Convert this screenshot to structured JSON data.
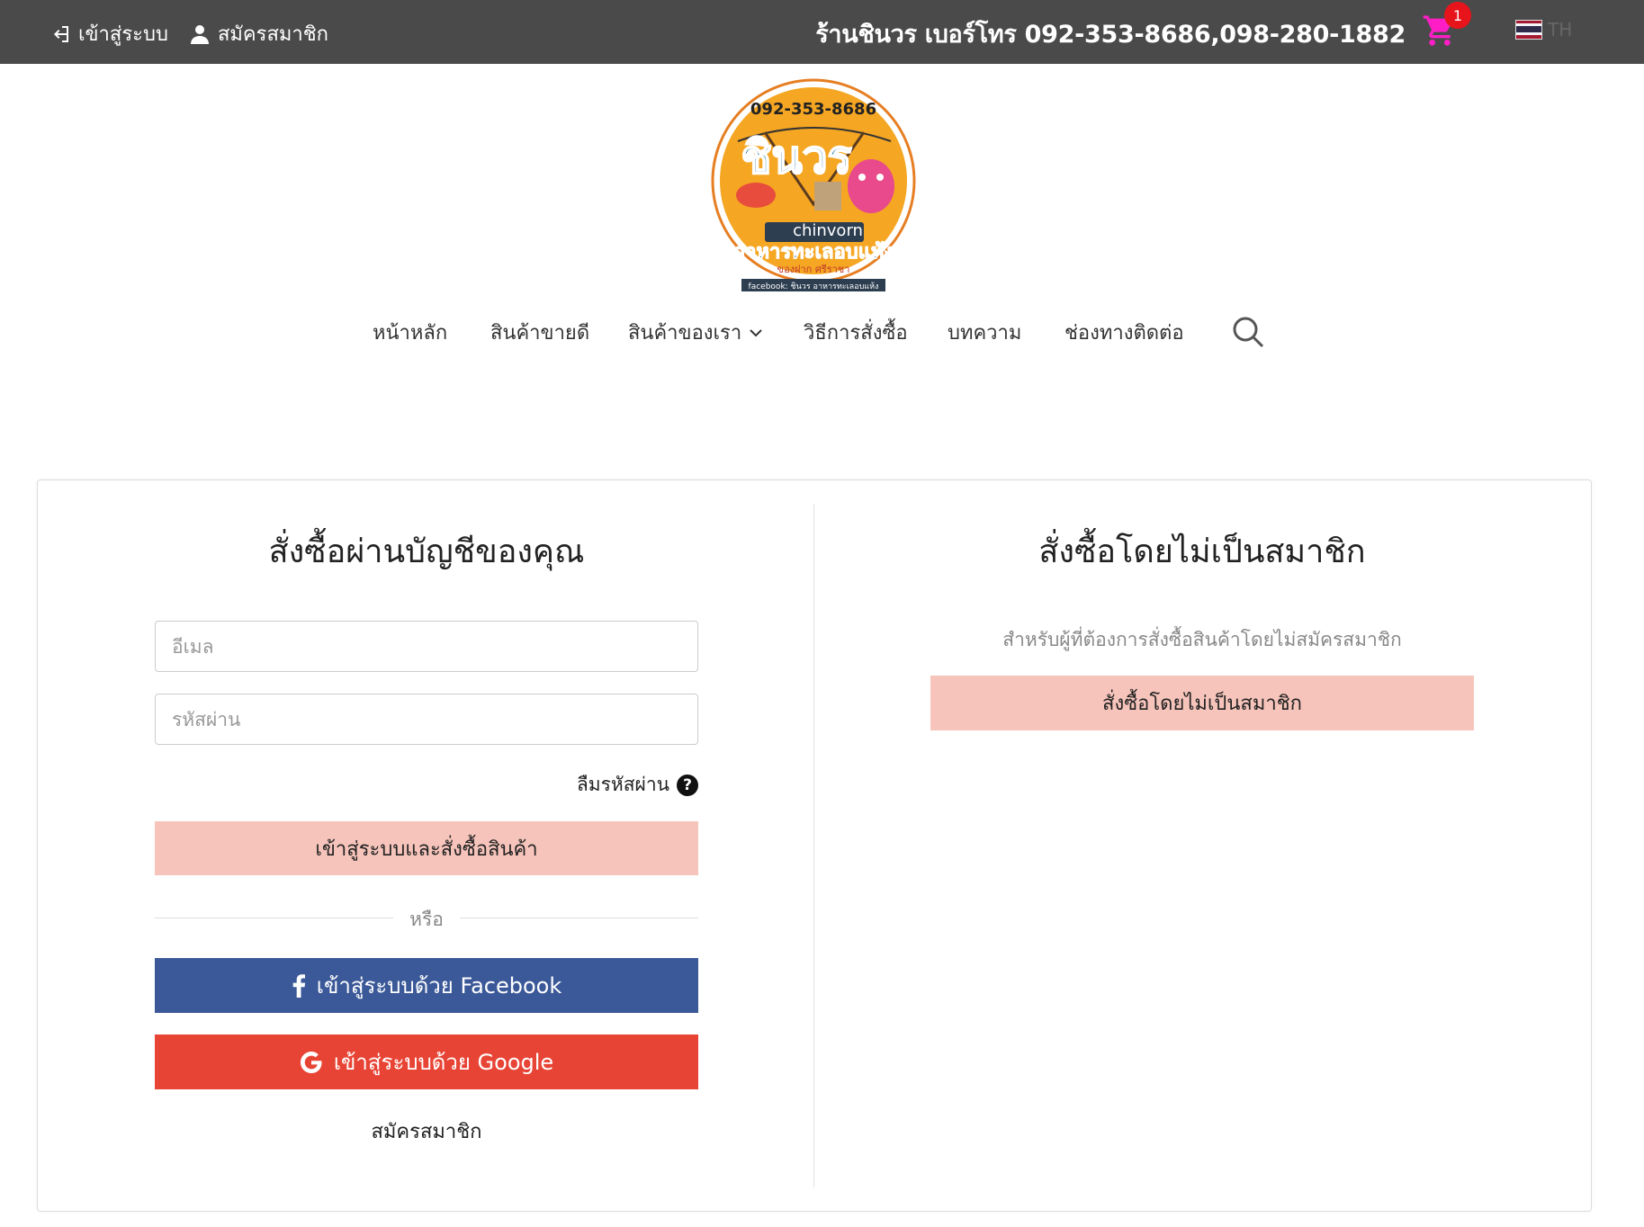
{
  "topbar": {
    "login_label": "เข้าสู่ระบบ",
    "register_label": "สมัครสมาชิก",
    "shop_phone": "ร้านชินวร เบอร์โทร 092-353-8686,098-280-1882",
    "cart_count": "1",
    "language": "TH"
  },
  "logo": {
    "phone": "092-353-8686",
    "brand": "ชินวร",
    "line_id": "chinvorn",
    "tagline": "อาหารทะเลอบแห้ง",
    "subtitle": "ของฝาก ศรีราชา",
    "facebook": "facebook: ชินวร อาหารทะเลอบแห้ง"
  },
  "nav": {
    "items": [
      {
        "label": "หน้าหลัก"
      },
      {
        "label": "สินค้าขายดี"
      },
      {
        "label": "สินค้าของเรา"
      },
      {
        "label": "วิธีการสั่งซื้อ"
      },
      {
        "label": "บทความ"
      },
      {
        "label": "ช่องทางติดต่อ"
      }
    ]
  },
  "member": {
    "title": "สั่งซื้อผ่านบัญชีของคุณ",
    "email_placeholder": "อีเมล",
    "password_placeholder": "รหัสผ่าน",
    "forgot_label": "ลืมรหัสผ่าน",
    "login_button": "เข้าสู่ระบบและสั่งซื้อสินค้า",
    "or_label": "หรือ",
    "facebook_button": "เข้าสู่ระบบด้วย Facebook",
    "google_button": "เข้าสู่ระบบด้วย Google",
    "register_link": "สมัครสมาชิก"
  },
  "guest": {
    "title": "สั่งซื้อโดยไม่เป็นสมาชิก",
    "description": "สำหรับผู้ที่ต้องการสั่งซื้อสินค้าโดยไม่สมัครสมาชิก",
    "button": "สั่งซื้อโดยไม่เป็นสมาชิก"
  },
  "colors": {
    "topbar_bg": "#4a4a4a",
    "cart": "#ff1ec6",
    "badge": "#e8141c",
    "primary_button": "#f6c4bb",
    "facebook": "#3b5998",
    "google": "#e84435"
  }
}
